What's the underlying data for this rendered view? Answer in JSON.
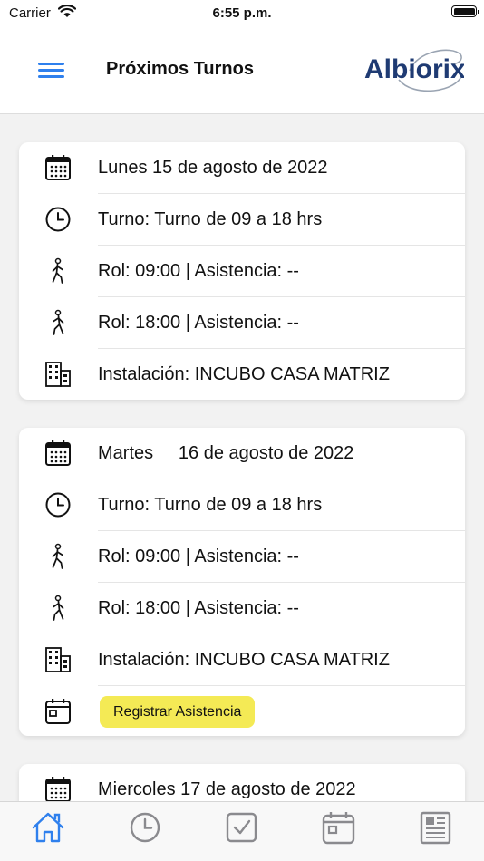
{
  "status_bar": {
    "carrier": "Carrier",
    "time": "6:55 p.m."
  },
  "header": {
    "title": "Próximos Turnos",
    "logo_text": "Albiorix",
    "menu_icon": "hamburger-menu-icon"
  },
  "colors": {
    "accent": "#2f80ed",
    "logo": "#1f3b73",
    "button": "#f4ea55",
    "background": "#f2f2f2"
  },
  "cards": [
    {
      "date": "Lunes 15 de agosto de 2022",
      "turno": "Turno: Turno de 09 a 18 hrs",
      "rol_entrada": "Rol: 09:00 | Asistencia: --",
      "rol_salida": "Rol: 18:00 | Asistencia: --",
      "instalacion": "Instalación: INCUBO CASA MATRIZ"
    },
    {
      "date": "Martes     16 de agosto de 2022",
      "turno": "Turno: Turno de 09 a 18 hrs",
      "rol_entrada": "Rol: 09:00 | Asistencia: --",
      "rol_salida": "Rol: 18:00 | Asistencia: --",
      "instalacion": "Instalación: INCUBO CASA MATRIZ",
      "action_label": "Registrar Asistencia"
    },
    {
      "date": "Miercoles 17 de agosto de 2022"
    }
  ],
  "tab_bar": {
    "tabs": [
      {
        "icon": "home-icon",
        "active": true
      },
      {
        "icon": "clock-icon",
        "active": false
      },
      {
        "icon": "checkbox-icon",
        "active": false
      },
      {
        "icon": "calendar-icon",
        "active": false
      },
      {
        "icon": "newspaper-icon",
        "active": false
      }
    ]
  }
}
